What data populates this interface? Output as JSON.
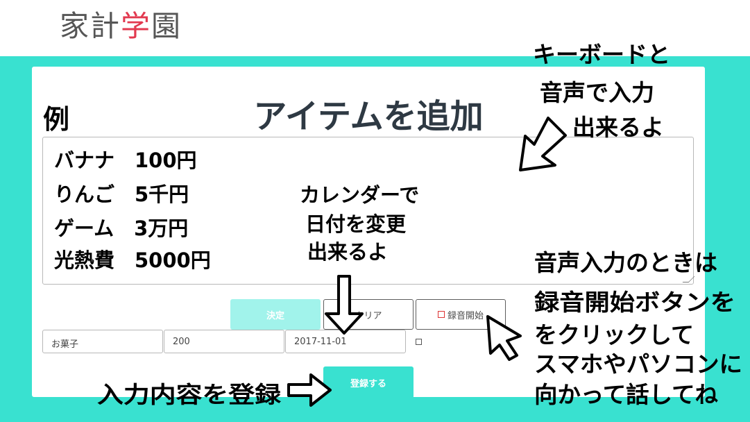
{
  "header": {
    "logo_char_1": "家",
    "logo_char_2": "計",
    "logo_char_3": "学",
    "logo_char_4": "園"
  },
  "form": {
    "title": "アイテムを追加",
    "decide_label": "決定",
    "clear_label": "クリア",
    "record_label": "録音開始",
    "name_value": "お菓子",
    "amount_value": "200",
    "date_value": "2017-11-01",
    "submit_label": "登録する"
  },
  "annotations": {
    "example_label": "例",
    "example_lines": [
      "バナナ　100円",
      "りんご　5千円",
      "ゲーム　3万円",
      "光熱費　5000円"
    ],
    "keyboard_note": [
      "キーボードと",
      "音声で入力",
      "出来るよ"
    ],
    "calendar_note": [
      "カレンダーで",
      "日付を変更",
      "出来るよ"
    ],
    "voice_note": [
      "音声入力のときは",
      "録音開始ボタンを",
      "をクリックして",
      "スマホやパソコンに",
      "向かって話してね"
    ],
    "submit_note": "入力内容を登録"
  },
  "colors": {
    "accent": "#39e1d0",
    "decide_bg": "#a1f3eb",
    "logo_red": "#e2394f",
    "logo_gray": "#565656"
  }
}
